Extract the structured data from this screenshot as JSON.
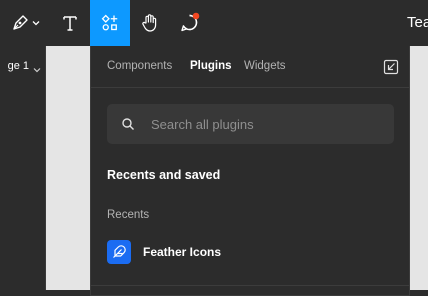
{
  "colors": {
    "toolbar_bg": "#2c2c2c",
    "accent": "#0d99ff",
    "canvas_bg": "#e5e5e5",
    "notification_dot": "#f24822",
    "plugin_icon_bg": "#1b6cf2"
  },
  "toolbar": {
    "tools": [
      {
        "icon": "pen-icon",
        "has_dropdown": true
      },
      {
        "icon": "text-icon"
      },
      {
        "icon": "resources-icon",
        "active": true
      },
      {
        "icon": "hand-icon"
      },
      {
        "icon": "comment-icon",
        "has_notification": true
      }
    ],
    "team_label": "Tea"
  },
  "left_panel": {
    "page_label": "ge 1"
  },
  "popover": {
    "tabs": [
      {
        "label": "Components",
        "active": false
      },
      {
        "label": "Plugins",
        "active": true
      },
      {
        "label": "Widgets",
        "active": false
      }
    ],
    "collapse_icon": "collapse-icon",
    "search": {
      "placeholder": "Search all plugins",
      "value": ""
    },
    "section_title": "Recents and saved",
    "recents_label": "Recents",
    "plugins": [
      {
        "name": "Feather Icons",
        "icon": "feather-icon"
      }
    ]
  }
}
